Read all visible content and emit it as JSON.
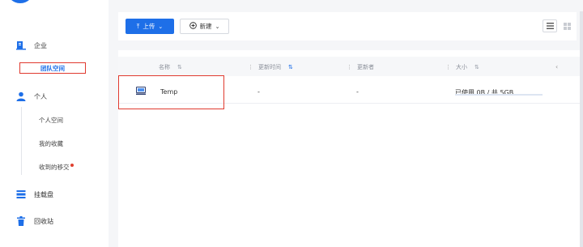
{
  "sidebar": {
    "enterprise": "企业",
    "team_space": "团队空间",
    "personal": "个人",
    "personal_space": "个人空间",
    "my_favorites": "我的收藏",
    "received_handoffs": "收到的移交",
    "mount_disk": "挂载盘",
    "recycle_bin": "回收站"
  },
  "toolbar": {
    "upload_label": "上传",
    "new_label": "新建"
  },
  "table": {
    "columns": {
      "name": "名称",
      "updated_time": "更新时间",
      "updater": "更新者",
      "size": "大小"
    },
    "rows": [
      {
        "name": "Temp",
        "updated_time": "-",
        "updater": "-",
        "size": "已使用 0B / 共 5GB",
        "usage_fraction": 0
      }
    ]
  },
  "colors": {
    "primary": "#1e6fe8",
    "highlight": "#e03a2f",
    "badge": "#e0402f"
  }
}
